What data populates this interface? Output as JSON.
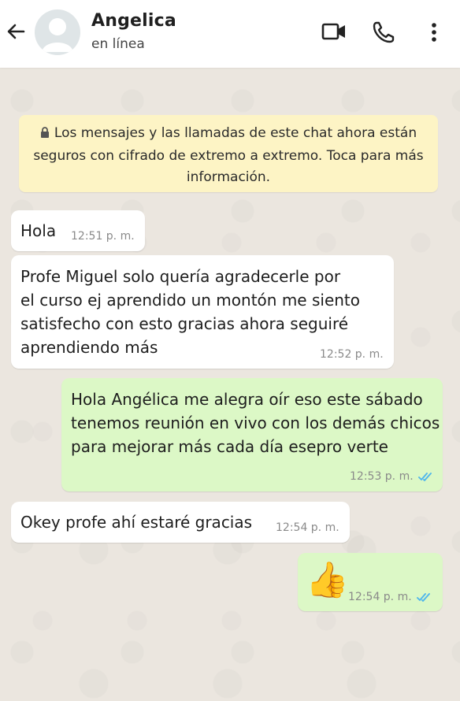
{
  "header": {
    "contact_name": "Angelica",
    "status": "en línea",
    "icons": [
      "back-arrow-icon",
      "avatar-icon",
      "video-call-icon",
      "phone-icon",
      "more-options-icon"
    ]
  },
  "encryption_notice": "Los mensajes y las llamadas de este chat ahora están seguros con cifrado de extremo a extremo. Toca para más información.",
  "messages": [
    {
      "direction": "in",
      "text": "Hola",
      "time": "12:51 p. m."
    },
    {
      "direction": "in",
      "text": "Profe Miguel solo quería agradecerle por\nel curso ej aprendido un montón me siento\nsatisfecho con esto gracias ahora seguiré\naprendiendo más",
      "time": "12:52 p. m."
    },
    {
      "direction": "out",
      "text": "Hola Angélica me alegra oír eso este sábado\ntenemos reunión en vivo con los demás chicos\npara mejorar más cada día esepro verte",
      "time": "12:53 p. m.",
      "read": true
    },
    {
      "direction": "in",
      "text": "Okey profe ahí estaré gracias",
      "time": "12:54 p. m."
    },
    {
      "direction": "out",
      "text": "👍",
      "time": "12:54 p. m.",
      "read": true
    }
  ],
  "colors": {
    "incoming_bubble": "#ffffff",
    "outgoing_bubble": "#dcf8c6",
    "banner": "#fdf4c5",
    "read_ticks": "#4fb6ec"
  }
}
